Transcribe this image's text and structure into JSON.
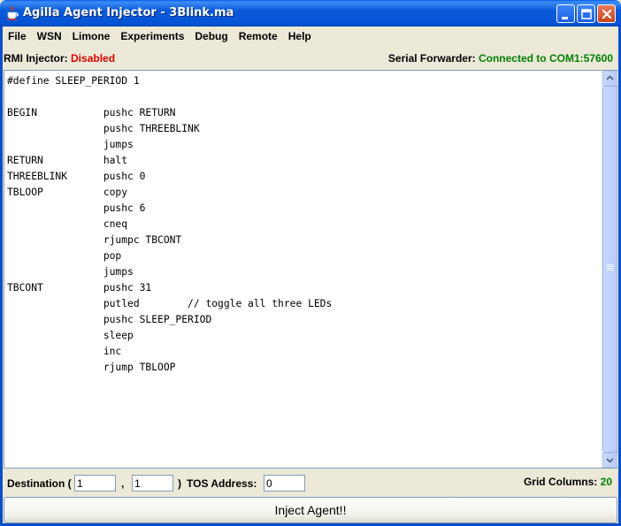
{
  "window": {
    "title": "Agilla Agent Injector - 3Blink.ma"
  },
  "menu": [
    "File",
    "WSN",
    "Limone",
    "Experiments",
    "Debug",
    "Remote",
    "Help"
  ],
  "status": {
    "rmi_label": "RMI Injector:",
    "rmi_value": "Disabled",
    "serial_label": "Serial Forwarder:",
    "serial_value": "Connected to COM1:57600"
  },
  "editor": {
    "code": "#define SLEEP_PERIOD 1\n\nBEGIN           pushc RETURN\n                pushc THREEBLINK\n                jumps\nRETURN          halt\nTHREEBLINK      pushc 0\nTBLOOP          copy\n                pushc 6\n                cneq\n                rjumpc TBCONT\n                pop\n                jumps\nTBCONT          pushc 31\n                putled        // toggle all three LEDs\n                pushc SLEEP_PERIOD\n                sleep\n                inc\n                rjump TBLOOP"
  },
  "controls": {
    "destination_label": "Destination (",
    "dest_x": "1",
    "comma": ",",
    "dest_y": "1",
    "close_paren": ")",
    "tos_label": "TOS Address:",
    "tos_value": "0",
    "grid_label": "Grid Columns:",
    "grid_value": "20"
  },
  "inject_button": "Inject Agent!!",
  "colors": {
    "titlebar": "#0a5ad8",
    "disabled": "#e00000",
    "connected": "#008000"
  },
  "icons": {
    "app": "java-cup-icon",
    "minimize": "minimize-icon",
    "maximize": "maximize-icon",
    "close": "close-icon"
  }
}
